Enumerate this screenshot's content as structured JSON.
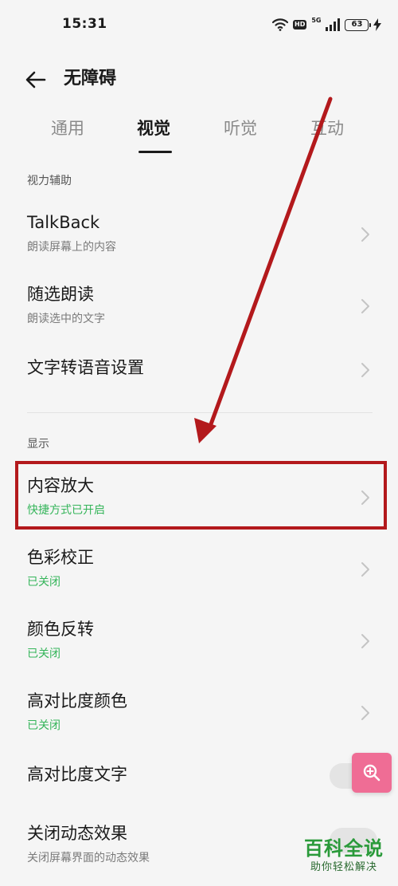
{
  "status_bar": {
    "time": "15:31",
    "network": "5G",
    "hd_badge": "HD",
    "battery": "63"
  },
  "header": {
    "title": "无障碍"
  },
  "tabs": [
    {
      "label": "通用",
      "active": false
    },
    {
      "label": "视觉",
      "active": true
    },
    {
      "label": "听觉",
      "active": false
    },
    {
      "label": "互动",
      "active": false
    }
  ],
  "sections": {
    "vision_assist": {
      "header": "视力辅助",
      "items": [
        {
          "title": "TalkBack",
          "subtitle": "朗读屏幕上的内容"
        },
        {
          "title": "随选朗读",
          "subtitle": "朗读选中的文字"
        },
        {
          "title": "文字转语音设置"
        }
      ]
    },
    "display": {
      "header": "显示",
      "items": [
        {
          "title": "内容放大",
          "subtitle": "快捷方式已开启"
        },
        {
          "title": "色彩校正",
          "subtitle": "已关闭"
        },
        {
          "title": "颜色反转",
          "subtitle": "已关闭"
        },
        {
          "title": "高对比度颜色",
          "subtitle": "已关闭"
        },
        {
          "title": "高对比度文字"
        },
        {
          "title": "关闭动态效果",
          "subtitle": "关闭屏幕界面的动态效果"
        }
      ]
    }
  },
  "colors": {
    "accent_green": "#35b55a",
    "highlight_red": "#b3191c",
    "fab_pink": "#ef6d95"
  },
  "watermark": {
    "title": "百科全说",
    "subtitle": "助你轻松解决"
  }
}
